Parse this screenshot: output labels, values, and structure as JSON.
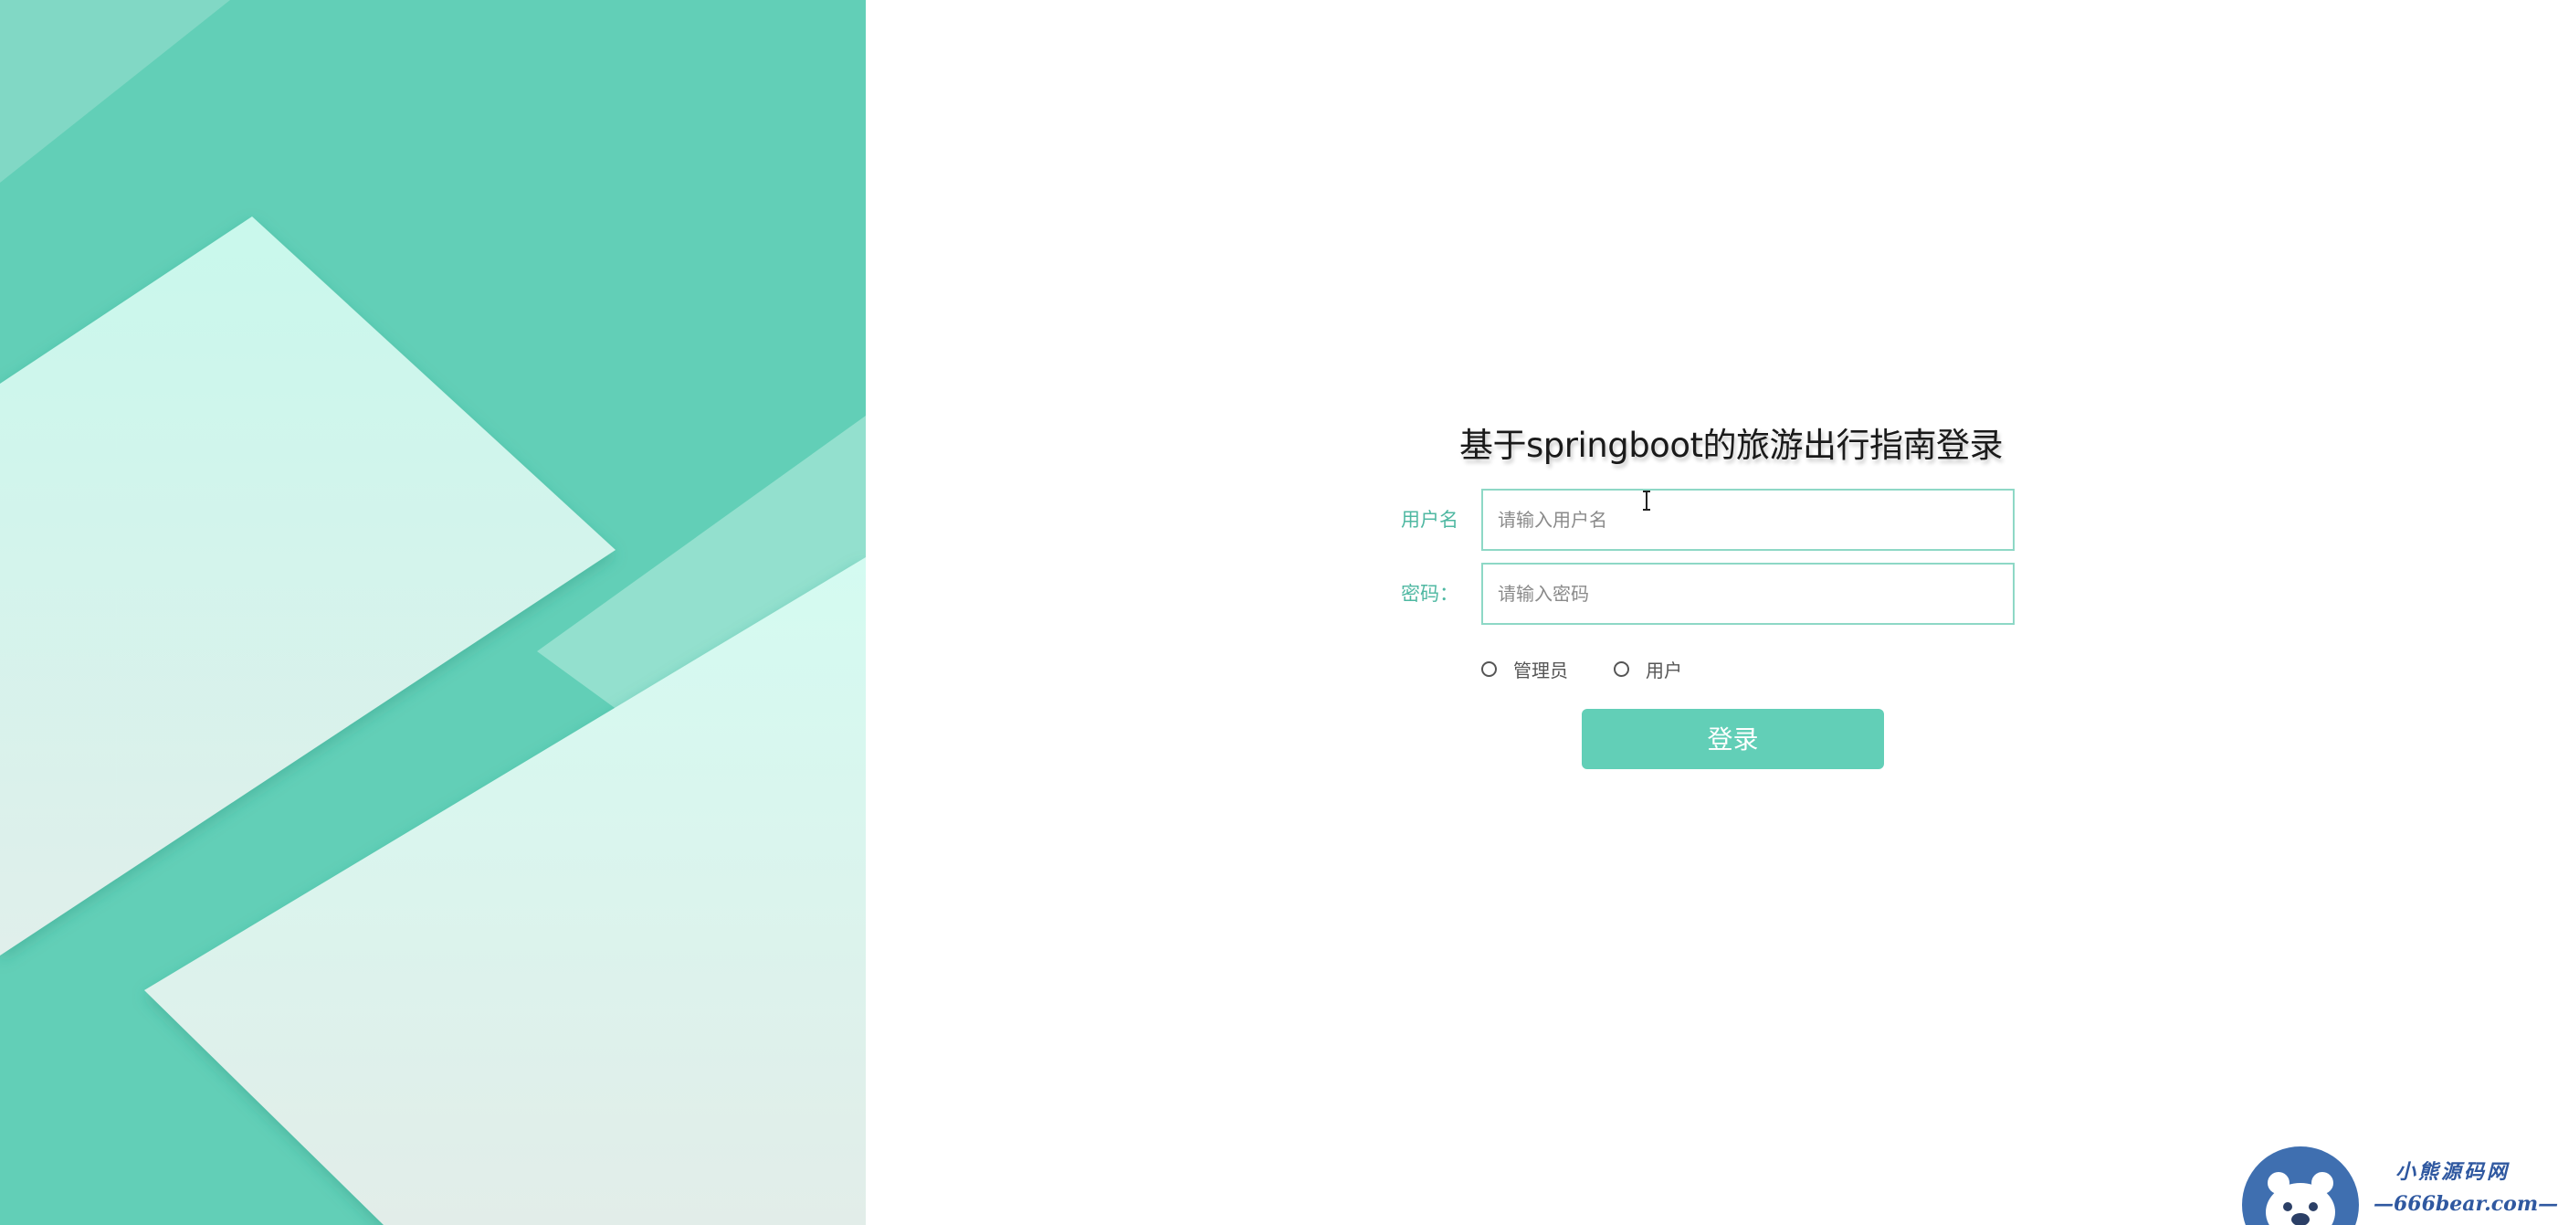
{
  "login": {
    "title": "基于springboot的旅游出行指南登录",
    "username_label": "用户名",
    "username_placeholder": "请输入用户名",
    "password_label": "密码：",
    "password_placeholder": "请输入密码",
    "roles": [
      "管理员",
      "用户"
    ],
    "submit_label": "登录"
  },
  "watermark": {
    "top_text": "小熊源码网",
    "bottom_text": "—666bear.com—"
  },
  "colors": {
    "accent": "#62cfb7",
    "label": "#4fb8a2",
    "input_border": "#8ed8c6",
    "shape_light": "#d6f7ef",
    "watermark_blue": "#2f58a0"
  },
  "icons": {
    "cursor": "ibeam-cursor-icon",
    "watermark_logo": "bear-logo-icon"
  }
}
